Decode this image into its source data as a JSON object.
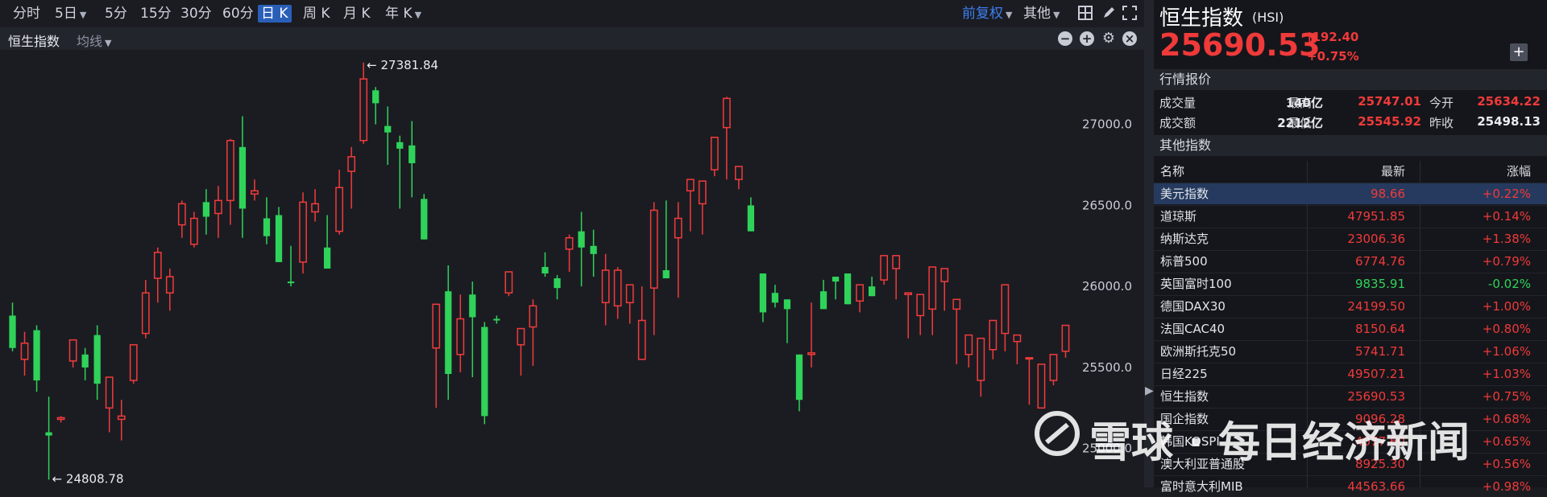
{
  "toolbar": {
    "periods": [
      {
        "label": "分时",
        "active": false
      },
      {
        "label": "5日",
        "active": false,
        "dropdown": true
      },
      {
        "label": "5分",
        "active": false
      },
      {
        "label": "15分",
        "active": false
      },
      {
        "label": "30分",
        "active": false
      },
      {
        "label": "60分",
        "active": false
      },
      {
        "label": "日 K",
        "active": true
      },
      {
        "label": "周 K",
        "active": false
      },
      {
        "label": "月 K",
        "active": false
      },
      {
        "label": "年 K",
        "active": false,
        "dropdown": true
      }
    ],
    "adjust_label": "前复权",
    "other_label": "其他",
    "icons": [
      "grid-icon",
      "pen-icon",
      "fullscreen-icon"
    ]
  },
  "chart_header": {
    "title": "恒生指数",
    "ma_label": "均线",
    "controls": [
      "zoom-out-icon",
      "zoom-in-icon",
      "settings-icon",
      "close-icon"
    ]
  },
  "chart_data": {
    "type": "candlestick",
    "y_ticks": [
      "27000.0",
      "26500.0",
      "26000.0",
      "25500.0",
      "25000.0"
    ],
    "ylim": [
      24800,
      27400
    ],
    "annotations": {
      "high": "27381.84",
      "low": "24808.78"
    },
    "colors": {
      "up": "#f23b3b",
      "down": "#2fd35a"
    },
    "candles": [
      [
        25820,
        25900,
        25600,
        25620
      ],
      [
        25550,
        25720,
        25450,
        25650
      ],
      [
        25730,
        25760,
        25350,
        25420
      ],
      [
        25100,
        25320,
        24808,
        25080
      ],
      [
        25180,
        25200,
        25160,
        25190
      ],
      [
        25540,
        25660,
        25500,
        25670
      ],
      [
        25580,
        25620,
        25420,
        25500
      ],
      [
        25700,
        25760,
        25300,
        25400
      ],
      [
        25250,
        25430,
        25100,
        25440
      ],
      [
        25180,
        25300,
        25050,
        25200
      ],
      [
        25420,
        25640,
        25400,
        25640
      ],
      [
        25710,
        26040,
        25680,
        25960
      ],
      [
        26050,
        26240,
        25900,
        26210
      ],
      [
        25960,
        26110,
        25850,
        26060
      ],
      [
        26380,
        26530,
        26300,
        26510
      ],
      [
        26260,
        26460,
        26240,
        26420
      ],
      [
        26520,
        26600,
        26320,
        26430
      ],
      [
        26450,
        26620,
        26300,
        26530
      ],
      [
        26530,
        26910,
        26380,
        26900
      ],
      [
        26860,
        27050,
        26300,
        26480
      ],
      [
        26570,
        26660,
        26530,
        26590
      ],
      [
        26420,
        26550,
        26260,
        26310
      ],
      [
        26440,
        26490,
        26150,
        26150
      ],
      [
        26030,
        26250,
        26000,
        26020
      ],
      [
        26150,
        26580,
        26080,
        26520
      ],
      [
        26460,
        26600,
        26400,
        26510
      ],
      [
        26240,
        26440,
        26120,
        26110
      ],
      [
        26340,
        26720,
        26320,
        26610
      ],
      [
        26710,
        26860,
        26480,
        26800
      ],
      [
        26900,
        27381,
        26880,
        27280
      ],
      [
        27210,
        27230,
        27000,
        27130
      ],
      [
        26990,
        27110,
        26750,
        26950
      ],
      [
        26890,
        26930,
        26480,
        26850
      ],
      [
        26870,
        27020,
        26550,
        26760
      ],
      [
        26540,
        26570,
        26300,
        26290
      ],
      [
        25620,
        25880,
        25250,
        25890
      ],
      [
        25970,
        26130,
        25300,
        25460
      ],
      [
        25580,
        25950,
        25470,
        25800
      ],
      [
        25950,
        26030,
        25440,
        25810
      ],
      [
        25750,
        25780,
        25150,
        25200
      ],
      [
        25800,
        25820,
        25770,
        25790
      ],
      [
        25960,
        26080,
        25940,
        26090
      ],
      [
        25640,
        25720,
        25450,
        25740
      ],
      [
        25750,
        25920,
        25510,
        25880
      ],
      [
        26120,
        26210,
        26060,
        26080
      ],
      [
        26050,
        26070,
        25920,
        25990
      ],
      [
        26230,
        26320,
        26090,
        26300
      ],
      [
        26340,
        26460,
        26000,
        26240
      ],
      [
        26250,
        26350,
        26060,
        26200
      ],
      [
        25900,
        26200,
        25760,
        26100
      ],
      [
        25880,
        26120,
        25800,
        26100
      ],
      [
        25900,
        25980,
        25770,
        26010
      ],
      [
        25550,
        26000,
        25550,
        25790
      ],
      [
        25990,
        26520,
        25700,
        26470
      ],
      [
        26100,
        26530,
        26060,
        26050
      ],
      [
        26300,
        26520,
        25930,
        26420
      ],
      [
        26590,
        26650,
        26340,
        26660
      ],
      [
        26510,
        26520,
        26320,
        26650
      ],
      [
        26720,
        26920,
        26680,
        26920
      ],
      [
        26980,
        27170,
        26660,
        27160
      ],
      [
        26660,
        26620,
        26600,
        26740
      ],
      [
        26500,
        26550,
        26400,
        26340
      ],
      [
        26080,
        26020,
        25780,
        25840
      ],
      [
        25960,
        26010,
        25870,
        25900
      ],
      [
        25920,
        25680,
        25650,
        25860
      ],
      [
        25580,
        25230,
        25230,
        25300
      ],
      [
        25580,
        25900,
        25500,
        25590
      ],
      [
        25970,
        26040,
        25910,
        25860
      ],
      [
        26060,
        25970,
        25920,
        26030
      ],
      [
        26080,
        26060,
        25920,
        25890
      ],
      [
        25910,
        25880,
        25840,
        26010
      ],
      [
        26000,
        26060,
        25990,
        25940
      ],
      [
        26040,
        26150,
        26010,
        26190
      ],
      [
        26110,
        25920,
        26090,
        26190
      ],
      [
        25950,
        25680,
        25880,
        25960
      ],
      [
        25820,
        25700,
        25700,
        25950
      ],
      [
        25860,
        25700,
        25920,
        26120
      ],
      [
        26030,
        25850,
        26050,
        26110
      ],
      [
        25860,
        25520,
        25850,
        25920
      ],
      [
        25580,
        25500,
        25500,
        25700
      ],
      [
        25420,
        25320,
        25400,
        25680
      ],
      [
        25610,
        25680,
        25550,
        25790
      ],
      [
        25710,
        25820,
        25600,
        26010
      ],
      [
        25660,
        25520,
        25660,
        25700
      ],
      [
        25560,
        25270,
        25270,
        25560
      ],
      [
        25250,
        25400,
        25250,
        25520
      ],
      [
        25420,
        25550,
        25390,
        25580
      ],
      [
        25600,
        25710,
        25560,
        25760
      ]
    ]
  },
  "quote": {
    "name": "恒生指数",
    "code": "(HSI)",
    "price": "25690.53",
    "change": "192.40",
    "change_pct": "+0.75%",
    "section_label": "行情报价",
    "rows": [
      {
        "l1": "成交量",
        "v1": "140亿",
        "l2": "最高",
        "v2": "25747.01",
        "l3": "今开",
        "v3": "25634.22"
      },
      {
        "l1": "成交额",
        "v1": "2212亿",
        "l2": "最低",
        "v2": "25545.92",
        "l3": "昨收",
        "v3": "25498.13"
      }
    ]
  },
  "other_indices": {
    "section_label": "其他指数",
    "headers": [
      "名称",
      "最新",
      "涨幅"
    ],
    "rows": [
      {
        "name": "美元指数",
        "latest": "98.66",
        "pct": "+0.22%",
        "dir": "up",
        "selected": true
      },
      {
        "name": "道琼斯",
        "latest": "47951.85",
        "pct": "+0.14%",
        "dir": "up"
      },
      {
        "name": "纳斯达克",
        "latest": "23006.36",
        "pct": "+1.38%",
        "dir": "up"
      },
      {
        "name": "标普500",
        "latest": "6774.76",
        "pct": "+0.79%",
        "dir": "up"
      },
      {
        "name": "英国富时100",
        "latest": "9835.91",
        "pct": "-0.02%",
        "dir": "down"
      },
      {
        "name": "德国DAX30",
        "latest": "24199.50",
        "pct": "+1.00%",
        "dir": "up"
      },
      {
        "name": "法国CAC40",
        "latest": "8150.64",
        "pct": "+0.80%",
        "dir": "up"
      },
      {
        "name": "欧洲斯托克50",
        "latest": "5741.71",
        "pct": "+1.06%",
        "dir": "up"
      },
      {
        "name": "日经225",
        "latest": "49507.21",
        "pct": "+1.03%",
        "dir": "up"
      },
      {
        "name": "恒生指数",
        "latest": "25690.53",
        "pct": "+0.75%",
        "dir": "up"
      },
      {
        "name": "国企指数",
        "latest": "9096.28",
        "pct": "+0.68%",
        "dir": "up"
      },
      {
        "name": "韩国KOSPI",
        "latest": "4077.60",
        "pct": "+0.65%",
        "dir": "up"
      },
      {
        "name": "澳大利亚普通股",
        "latest": "8925.30",
        "pct": "+0.56%",
        "dir": "up"
      },
      {
        "name": "富时意大利MIB",
        "latest": "44563.66",
        "pct": "+0.98%",
        "dir": "up"
      }
    ]
  },
  "watermark": "雪球 · 每日经济新闻"
}
